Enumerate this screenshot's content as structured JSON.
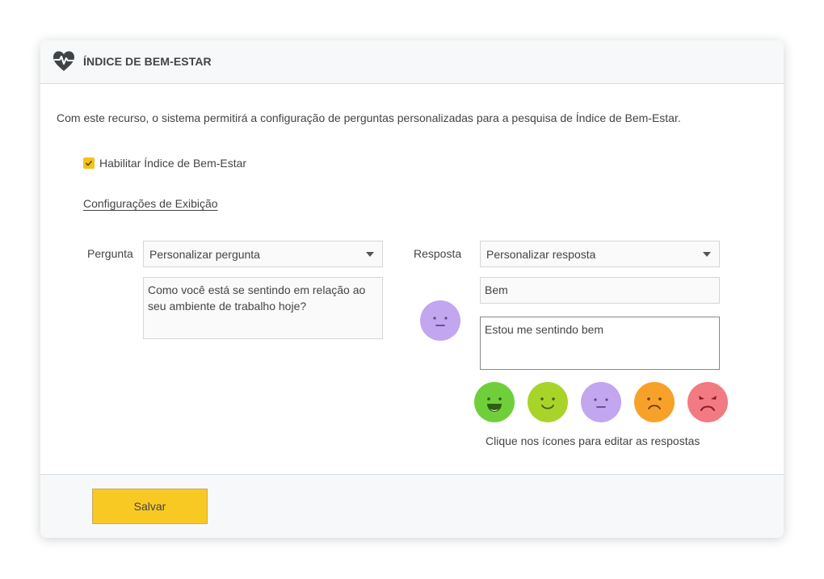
{
  "header": {
    "title": "ÍNDICE DE BEM-ESTAR",
    "icon": "heart-pulse-icon"
  },
  "description": "Com este recurso, o sistema permitirá a configuração de perguntas personalizadas para a pesquisa de Índice de Bem-Estar.",
  "enable": {
    "label": "Habilitar Índice de Bem-Estar",
    "checked": true
  },
  "config_link": "Configurações de Exibição",
  "question": {
    "label": "Pergunta",
    "select_value": "Personalizar pergunta",
    "text": "Como você está se sentindo em relação ao seu ambiente de trabalho hoje?"
  },
  "answer": {
    "label": "Resposta",
    "select_value": "Personalizar resposta",
    "title_value": "Bem",
    "description_value": "Estou me sentindo bem"
  },
  "emojis": [
    {
      "name": "very-happy",
      "color": "#6fcf3a"
    },
    {
      "name": "happy",
      "color": "#a8d42a"
    },
    {
      "name": "neutral",
      "color": "#c2a6f0"
    },
    {
      "name": "sad",
      "color": "#f7a12a"
    },
    {
      "name": "angry",
      "color": "#f27a82"
    }
  ],
  "hint": "Clique nos ícones para editar as respostas",
  "footer": {
    "save_label": "Salvar"
  },
  "colors": {
    "accent": "#f9c923",
    "checkbox": "#f3c21b"
  }
}
